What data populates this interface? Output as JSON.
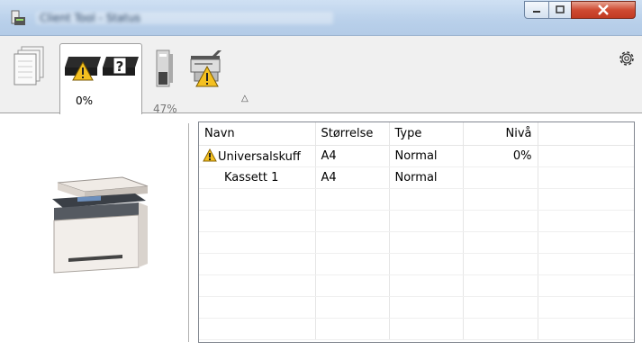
{
  "window": {
    "title": "Client Tool - Status",
    "controls": {
      "minimize": "minimize",
      "maximize": "maximize",
      "close": "close"
    }
  },
  "tabs": [
    {
      "id": "documents",
      "icon": "documents-icon",
      "label": ""
    },
    {
      "id": "supplies",
      "icon": "toner-warning-icon",
      "label": "0%",
      "selected": true
    },
    {
      "id": "waste-toner",
      "icon": "waste-toner-icon",
      "label": "47%"
    },
    {
      "id": "paper-tray",
      "icon": "tray-warning-icon",
      "label": ""
    }
  ],
  "toolbar": {
    "collapse_icon": "chevron-up-icon",
    "settings_icon": "gear-icon"
  },
  "table": {
    "columns": [
      "Navn",
      "Størrelse",
      "Type",
      "Nivå"
    ],
    "rows": [
      {
        "warning": true,
        "name": "Universalskuff",
        "size": "A4",
        "type": "Normal",
        "level": "0%"
      },
      {
        "warning": false,
        "name": "Kassett 1",
        "size": "A4",
        "type": "Normal",
        "level": ""
      }
    ],
    "empty_rows": 7
  },
  "colors": {
    "warning": "#f4c020",
    "titlebar": "#bcd2ec",
    "close": "#c94530"
  }
}
